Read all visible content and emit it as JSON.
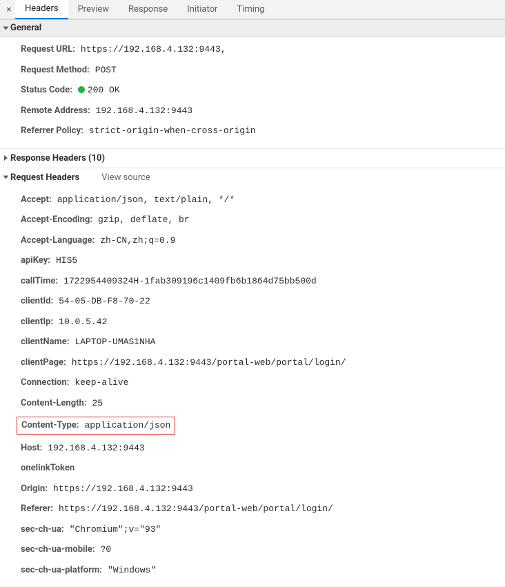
{
  "tabs": {
    "headers": "Headers",
    "preview": "Preview",
    "response": "Response",
    "initiator": "Initiator",
    "timing": "Timing"
  },
  "sections": {
    "general": "General",
    "responseHeaders": "Response Headers (10)",
    "requestHeaders": "Request Headers",
    "viewSource": "View source"
  },
  "general": {
    "requestUrl": {
      "k": "Request URL",
      "v": "https://192.168.4.132:9443,"
    },
    "requestMethod": {
      "k": "Request Method",
      "v": "POST"
    },
    "statusCode": {
      "k": "Status Code",
      "v": "200 OK"
    },
    "remoteAddress": {
      "k": "Remote Address",
      "v": "192.168.4.132:9443"
    },
    "referrerPolicy": {
      "k": "Referrer Policy",
      "v": "strict-origin-when-cross-origin"
    }
  },
  "reqHeaders": {
    "accept": {
      "k": "Accept",
      "v": "application/json, text/plain, */*"
    },
    "acceptEncoding": {
      "k": "Accept-Encoding",
      "v": "gzip, deflate, br"
    },
    "acceptLanguage": {
      "k": "Accept-Language",
      "v": "zh-CN,zh;q=0.9"
    },
    "apiKey": {
      "k": "apiKey",
      "v": "HIS5"
    },
    "callTime": {
      "k": "callTime",
      "v": "1722954409324H-1fab309196c1409fb6b1864d75bb500d"
    },
    "clientId": {
      "k": "clientId",
      "v": "54-05-DB-F8-70-22"
    },
    "clientIp": {
      "k": "clientIp",
      "v": "10.0.5.42"
    },
    "clientName": {
      "k": "clientName",
      "v": "LAPTOP-UMAS1NHA"
    },
    "clientPage": {
      "k": "clientPage",
      "v": "https://192.168.4.132:9443/portal-web/portal/login/"
    },
    "connection": {
      "k": "Connection",
      "v": "keep-alive"
    },
    "contentLength": {
      "k": "Content-Length",
      "v": "25"
    },
    "contentType": {
      "k": "Content-Type",
      "v": "application/json"
    },
    "host": {
      "k": "Host",
      "v": "192.168.4.132:9443"
    },
    "onelinkToken": {
      "k": "onelinkToken",
      "v": ""
    },
    "origin": {
      "k": "Origin",
      "v": "https://192.168.4.132:9443"
    },
    "referer": {
      "k": "Referer",
      "v": "https://192.168.4.132:9443/portal-web/portal/login/"
    },
    "secChUa": {
      "k": "sec-ch-ua",
      "v": "\"Chromium\";v=\"93\""
    },
    "secChUaMobile": {
      "k": "sec-ch-ua-mobile",
      "v": "?0"
    },
    "secChUaPlatform": {
      "k": "sec-ch-ua-platform",
      "v": "\"Windows\""
    }
  },
  "colors": {
    "highlightBorder": "#d93025",
    "statusGreen": "#1cb53f",
    "tabActive": "#1a73e8"
  }
}
